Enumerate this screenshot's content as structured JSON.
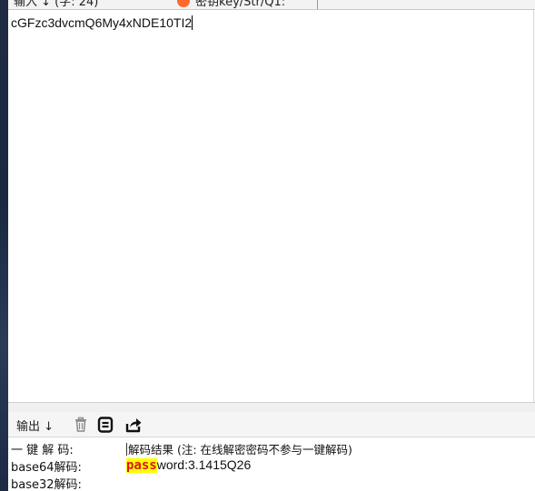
{
  "top_bar": {
    "input_label": "输入 ↓ (字: 24)",
    "key_label": "密钥key/Str/Q1:"
  },
  "input": {
    "value": "cGFzc3dvcmQ6My4xNDE10TI2"
  },
  "output_toolbar": {
    "label": "输出 ↓",
    "icons": [
      "trash-icon",
      "copy-icon",
      "share-icon"
    ]
  },
  "output_rows": [
    {
      "name": "一 键 解 码:",
      "value": "解码结果 (注: 在线解密密码不参与一键解码)"
    },
    {
      "name": "base64解码:",
      "value_highlight": "pass",
      "value_rest": "word:3.1415Q26"
    },
    {
      "name": "base32解码:",
      "value": ""
    }
  ],
  "colors": {
    "highlight_bg": "#ffff00",
    "highlight_fg": "#e3131b",
    "accent_orange": "#ff6a2b"
  }
}
